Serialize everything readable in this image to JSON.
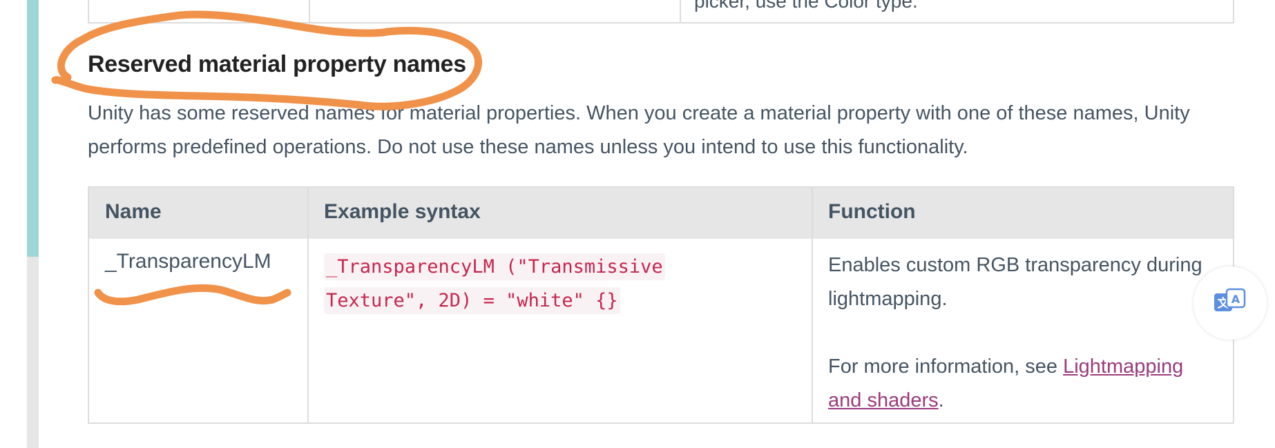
{
  "prev_table": {
    "partial_text": "picker, use the Color type."
  },
  "section": {
    "heading": "Reserved material property names",
    "intro": "Unity has some reserved names for material properties. When you create a material property with one of these names, Unity performs predefined operations. Do not use these names unless you intend to use this functionality."
  },
  "table": {
    "headers": {
      "name": "Name",
      "syntax": "Example syntax",
      "function": "Function"
    },
    "rows": [
      {
        "name": "_TransparencyLM",
        "syntax": "_TransparencyLM (\"Transmissive Texture\", 2D) = \"white\" {}",
        "function_text": "Enables custom RGB transparency during lightmapping.",
        "more_info_prefix": "For more information, see ",
        "more_info_link": "Lightmapping and shaders",
        "more_info_suffix": "."
      }
    ]
  },
  "colors": {
    "annotation": "#f0924a",
    "link": "#9b3a7b",
    "code": "#c7254e",
    "rail_thumb": "#9dd6d6",
    "header_bg": "#e6e6e6"
  },
  "icons": {
    "translate": "translate-icon"
  }
}
